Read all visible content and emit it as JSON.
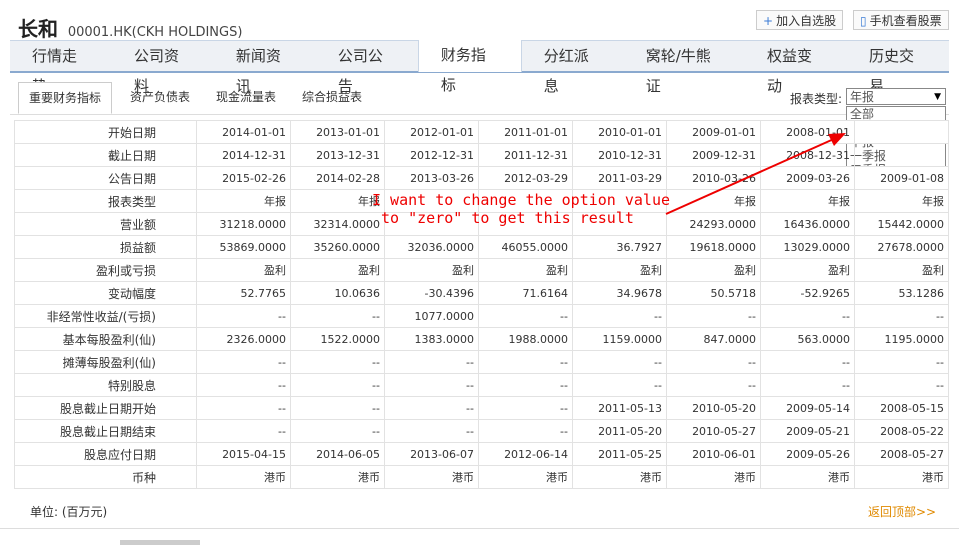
{
  "header": {
    "name_cn": "长和",
    "code": "00001.HK(CKH HOLDINGS)",
    "add_watch": "加入自选股",
    "mobile_view": "手机查看股票"
  },
  "tabs": [
    "行情走势",
    "公司资料",
    "新闻资讯",
    "公司公告",
    "财务指标",
    "分红派息",
    "窝轮/牛熊证",
    "权益变动",
    "历史交易"
  ],
  "subtabs": [
    "重要财务指标",
    "资产负债表",
    "现金流量表",
    "综合损益表"
  ],
  "report_type_label": "报表类型:",
  "select": {
    "value": "年报",
    "options": [
      "全部",
      "年报",
      "中报",
      "一季报",
      "三季报"
    ]
  },
  "table": {
    "rows": [
      {
        "label": "开始日期",
        "cells": [
          "2014-01-01",
          "2013-01-01",
          "2012-01-01",
          "2011-01-01",
          "2010-01-01",
          "2009-01-01",
          "2008-01-01",
          ""
        ]
      },
      {
        "label": "截止日期",
        "cells": [
          "2014-12-31",
          "2013-12-31",
          "2012-12-31",
          "2011-12-31",
          "2010-12-31",
          "2009-12-31",
          "2008-12-31",
          ""
        ]
      },
      {
        "label": "公告日期",
        "cells": [
          "2015-02-26",
          "2014-02-28",
          "2013-03-26",
          "2012-03-29",
          "2011-03-29",
          "2010-03-26",
          "2009-03-26",
          "2009-01-08"
        ]
      },
      {
        "label": "报表类型",
        "cells": [
          "年报",
          "年报",
          "",
          "",
          "",
          "年报",
          "年报",
          "年报"
        ]
      },
      {
        "label": "营业额",
        "cells": [
          "31218.0000",
          "32314.0000",
          "",
          "",
          "",
          "24293.0000",
          "16436.0000",
          "15442.0000"
        ]
      },
      {
        "label": "损益额",
        "cells": [
          "53869.0000",
          "35260.0000",
          "32036.0000",
          "46055.0000",
          "36.7927",
          "19618.0000",
          "13029.0000",
          "27678.0000"
        ]
      },
      {
        "label": "盈利或亏损",
        "cells": [
          "盈利",
          "盈利",
          "盈利",
          "盈利",
          "盈利",
          "盈利",
          "盈利",
          "盈利"
        ]
      },
      {
        "label": "变动幅度",
        "cells": [
          "52.7765",
          "10.0636",
          "-30.4396",
          "71.6164",
          "34.9678",
          "50.5718",
          "-52.9265",
          "53.1286"
        ]
      },
      {
        "label": "非经常性收益/(亏损)",
        "cells": [
          "--",
          "--",
          "1077.0000",
          "--",
          "--",
          "--",
          "--",
          "--"
        ]
      },
      {
        "label": "基本每股盈利(仙)",
        "cells": [
          "2326.0000",
          "1522.0000",
          "1383.0000",
          "1988.0000",
          "1159.0000",
          "847.0000",
          "563.0000",
          "1195.0000"
        ]
      },
      {
        "label": "摊薄每股盈利(仙)",
        "cells": [
          "--",
          "--",
          "--",
          "--",
          "--",
          "--",
          "--",
          "--"
        ]
      },
      {
        "label": "特别股息",
        "cells": [
          "--",
          "--",
          "--",
          "--",
          "--",
          "--",
          "--",
          "--"
        ]
      },
      {
        "label": "股息截止日期开始",
        "cells": [
          "--",
          "--",
          "--",
          "--",
          "2011-05-13",
          "2010-05-20",
          "2009-05-14",
          "2008-05-15"
        ]
      },
      {
        "label": "股息截止日期结束",
        "cells": [
          "--",
          "--",
          "--",
          "--",
          "2011-05-20",
          "2010-05-27",
          "2009-05-21",
          "2008-05-22"
        ]
      },
      {
        "label": "股息应付日期",
        "cells": [
          "2015-04-15",
          "2014-06-05",
          "2013-06-07",
          "2012-06-14",
          "2011-05-25",
          "2010-06-01",
          "2009-05-26",
          "2008-05-27"
        ]
      },
      {
        "label": "币种",
        "cells": [
          "港币",
          "港币",
          "港币",
          "港币",
          "港币",
          "港币",
          "港币",
          "港币"
        ]
      }
    ]
  },
  "unit_text": "单位: (百万元)",
  "back_top": "返回顶部>>",
  "annotation": "I want to change the option value\n to \"zero\" to get this result",
  "colors": {
    "accent": "#3178d6",
    "annotation": "#e00000",
    "link": "#e08a00"
  }
}
